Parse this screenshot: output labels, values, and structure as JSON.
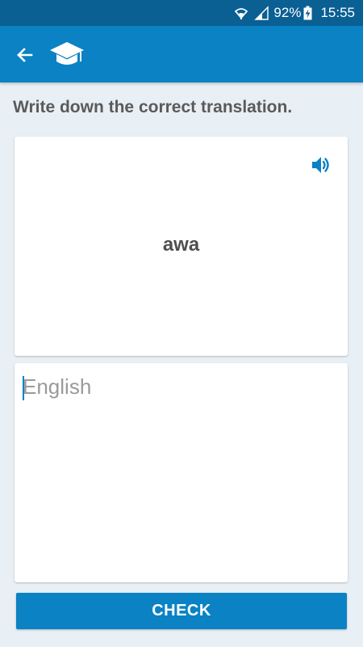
{
  "status_bar": {
    "battery_percent": "92%",
    "time": "15:55",
    "icons": [
      "wifi-icon",
      "signal-icon",
      "battery-charging-icon"
    ]
  },
  "app_bar": {
    "back_icon": "arrow-back-icon",
    "logo_icon": "graduation-cap-icon"
  },
  "exercise": {
    "instruction": "Write down the correct translation.",
    "word": "awa",
    "speaker_icon": "speaker-icon",
    "answer": {
      "value": "",
      "placeholder": "English"
    },
    "check_label": "CHECK"
  },
  "colors": {
    "status_bar": "#0a5f93",
    "accent": "#0a82c4",
    "background": "#e8eff5",
    "card": "#ffffff",
    "instruction_text": "#5a5a5a"
  }
}
